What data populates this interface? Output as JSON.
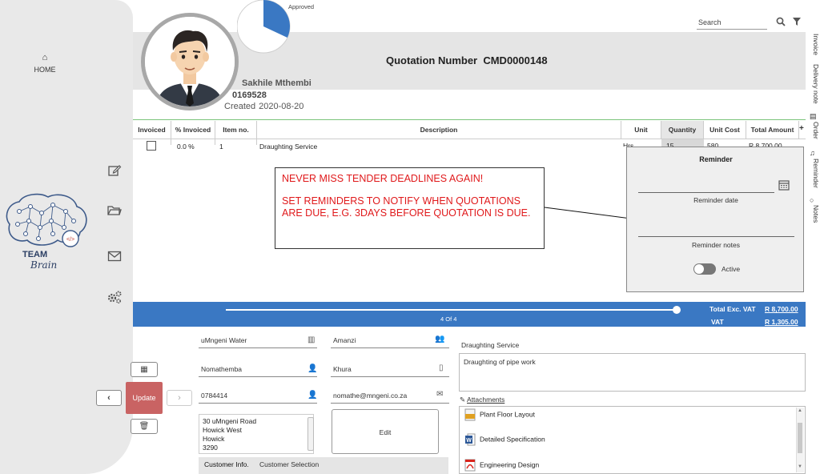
{
  "sidebar": {
    "home_label": "HOME",
    "logo_team": "TEAM",
    "logo_brain": "Brain"
  },
  "pie": {
    "label": "Approved",
    "fraction": 0.32,
    "color": "#3a78c3"
  },
  "header": {
    "title": "Quotation Number",
    "quote_number": "CMD0000148",
    "customer_name": "Sakhile Mthembi",
    "customer_number": "0169528",
    "created_label": "Created",
    "created_date": "2020-08-20"
  },
  "search": {
    "placeholder": "Search"
  },
  "right_tabs": [
    "Invoice",
    "Delivery note",
    "Order",
    "Reminder",
    "Notes"
  ],
  "table": {
    "columns": [
      "Invoiced",
      "% Invoiced",
      "Item no.",
      "Description",
      "Unit",
      "Quantity",
      "Unit Cost",
      "Total Amount"
    ],
    "rows": [
      {
        "invoiced": false,
        "percent": "0.0 %",
        "item_no": "1",
        "description": "Draughting Service",
        "unit": "Hrs",
        "quantity": "15",
        "unit_cost": "580",
        "total": "R 8,700.00"
      }
    ]
  },
  "reminder": {
    "title": "Reminder",
    "date_label": "Reminder date",
    "notes_label": "Reminder notes",
    "active_label": "Active",
    "active": false
  },
  "callout": {
    "line1": "NEVER MISS TENDER DEADLINES AGAIN!",
    "line2": "SET REMINDERS TO NOTIFY WHEN QUOTATIONS ARE DUE, E.G. 3DAYS BEFORE QUOTATION IS DUE."
  },
  "pager": {
    "label": "4 Of 4",
    "progress": 1.0
  },
  "totals": {
    "excl_label": "Total Exc. VAT",
    "excl_value": "R 8,700.00",
    "vat_label": "VAT",
    "vat_value": "R 1,305.00"
  },
  "customer": {
    "company": "uMngeni Water",
    "first_name": "Nomathemba",
    "phone": "0784414",
    "address": [
      "30 uMngeni Road",
      "Howick West",
      "Howick",
      "3290"
    ],
    "group": "Amanzi",
    "surname": "Khura",
    "email": "nomathe@mngeni.co.za",
    "edit_label": "Edit"
  },
  "buttons": {
    "update_label": "Update"
  },
  "bottom_tabs": [
    "Customer Info.",
    "Customer Selection"
  ],
  "description": {
    "title": "Draughting Service",
    "body": "Draughting of pipe work"
  },
  "attachments": {
    "label": "Attachments",
    "items": [
      {
        "name": "Plant Floor Layout",
        "icon": "dwg-file-icon",
        "color": "#e0a020"
      },
      {
        "name": "Detailed Specification",
        "icon": "word-file-icon",
        "color": "#2b5797"
      },
      {
        "name": "Engineering Design",
        "icon": "pdf-file-icon",
        "color": "#d9251d"
      }
    ]
  }
}
